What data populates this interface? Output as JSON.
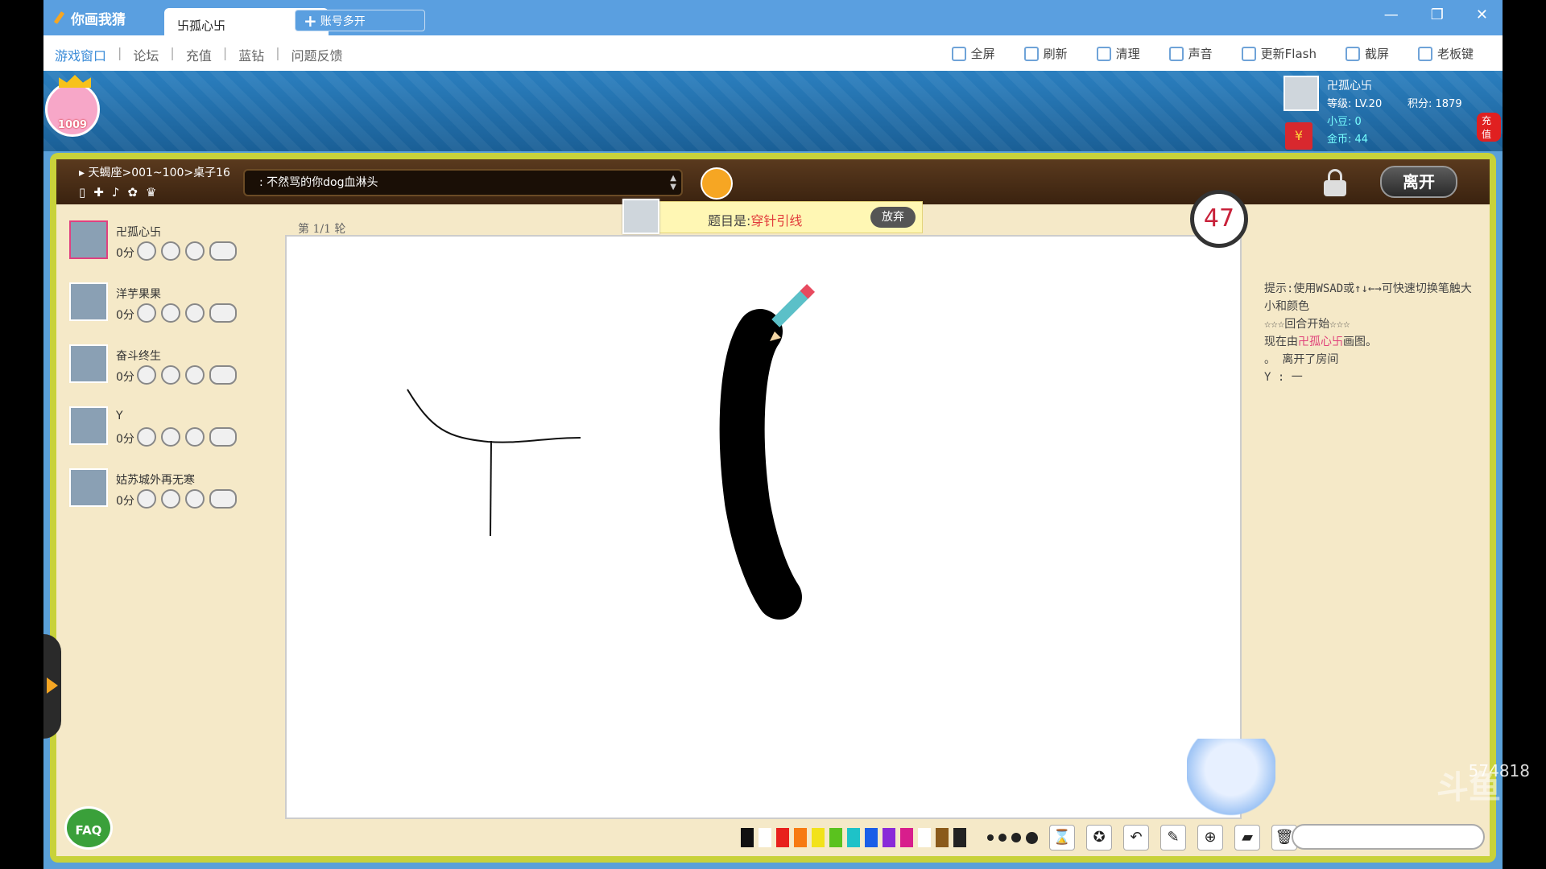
{
  "window": {
    "app_title": "你画我猜",
    "tab_label": "卐孤心卐",
    "new_tab_label": "账号多开"
  },
  "menu": {
    "left_items": [
      "游戏窗口",
      "论坛",
      "充值",
      "蓝钻",
      "问题反馈"
    ],
    "right_items": [
      "全屏",
      "刷新",
      "清理",
      "声音",
      "更新Flash",
      "截屏",
      "老板键"
    ]
  },
  "header": {
    "level_badge": "1009",
    "user": {
      "name": "卍孤心卐",
      "level": "等级: LV.20",
      "score": "积分: 1879",
      "beans": "小豆: 0",
      "gold": "金币: 44",
      "recharge": "充值"
    }
  },
  "room": {
    "info": "天蝎座>001~100>桌子16",
    "chat_text": ": 不然骂的你dog血淋头",
    "leave_label": "离开"
  },
  "players": [
    {
      "name": "卍孤心卐",
      "score": "0分"
    },
    {
      "name": "洋芋果果",
      "score": "0分"
    },
    {
      "name": "奋斗终生",
      "score": "0分"
    },
    {
      "name": "Y",
      "score": "0分"
    },
    {
      "name": "姑苏城外再无寒",
      "score": "0分"
    }
  ],
  "game": {
    "round": "第 1/1 轮",
    "prompt_prefix": "题目是:",
    "prompt_answer": "穿针引线",
    "giveup_label": "放弃",
    "timer": "47"
  },
  "hint": {
    "line1": "提示:使用WSAD或↑↓←→可快速切换笔触大小和颜色",
    "line2": "☆☆☆回合开始☆☆☆",
    "line3_prefix": "现在由",
    "line3_name": "卍孤心卐",
    "line3_suffix": "画图。",
    "line4": "。 离开了房间",
    "line5": "Y : 一"
  },
  "toolbar": {
    "colors": [
      "#111111",
      "#ffffff",
      "#e8201c",
      "#f77a12",
      "#f2e21a",
      "#5ac21e",
      "#1ec2c8",
      "#1a5ee8",
      "#8a2ad8",
      "#d81e8c",
      "#ffffff",
      "#8a5a1a",
      "#222222"
    ]
  },
  "faq_label": "FAQ",
  "watermark": "574818"
}
